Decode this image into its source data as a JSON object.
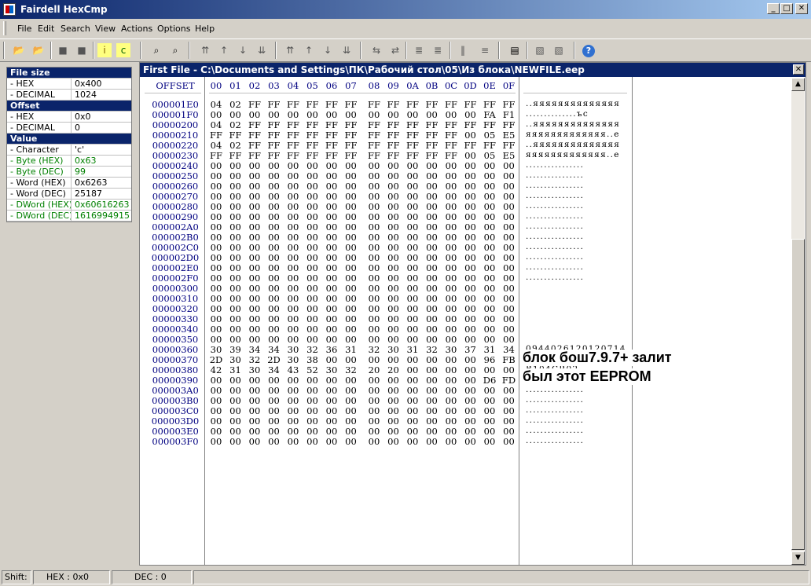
{
  "window": {
    "title": "Fairdell HexCmp"
  },
  "menu": [
    "File",
    "Edit",
    "Search",
    "View",
    "Actions",
    "Options",
    "Help"
  ],
  "toolbar": {
    "icons": [
      "open-file-1-icon",
      "open-file-2-icon",
      "stop-icon",
      "close-files-icon",
      "info-panel-icon",
      "compare-icon",
      "find-icon",
      "find-next-icon",
      "first-diff-icon",
      "prev-diff-icon",
      "next-diff-icon",
      "last-diff-icon",
      "first-block-icon",
      "prev-block-icon",
      "next-block-icon",
      "last-block-icon",
      "sync-left-icon",
      "sync-right-icon",
      "copy-left-icon",
      "copy-right-icon",
      "columns-icon",
      "lines-icon",
      "report-icon",
      "merge-left-icon",
      "merge-right-icon",
      "help-icon"
    ]
  },
  "info_panel": {
    "rows": [
      {
        "k": "File size",
        "v": "",
        "style": "hdr"
      },
      {
        "k": " - HEX",
        "v": "0x400",
        "style": ""
      },
      {
        "k": " - DECIMAL",
        "v": "1024",
        "style": ""
      },
      {
        "k": "Offset",
        "v": "",
        "style": "hdr"
      },
      {
        "k": " - HEX",
        "v": "0x0",
        "style": ""
      },
      {
        "k": " - DECIMAL",
        "v": "0",
        "style": ""
      },
      {
        "k": "Value",
        "v": "",
        "style": "hdr"
      },
      {
        "k": " - Character",
        "v": "'c'",
        "style": ""
      },
      {
        "k": " - Byte (HEX)",
        "v": "0x63",
        "style": "green"
      },
      {
        "k": " - Byte (DEC)",
        "v": "99",
        "style": "green"
      },
      {
        "k": " - Word (HEX)",
        "v": "0x6263",
        "style": ""
      },
      {
        "k": " - Word (DEC)",
        "v": "25187",
        "style": ""
      },
      {
        "k": " - DWord (HEX)",
        "v": "0x60616263",
        "style": "green"
      },
      {
        "k": " - DWord (DEC)",
        "v": "1616994915",
        "style": "green"
      }
    ]
  },
  "file_window": {
    "title": "First File - C:\\Documents and Settings\\ПК\\Рабочий стол\\05\\Из блока\\NEWFILE.eep",
    "offset_header": "OFFSET",
    "col_headers": [
      "00",
      "01",
      "02",
      "03",
      "04",
      "05",
      "06",
      "07",
      "08",
      "09",
      "0A",
      "0B",
      "0C",
      "0D",
      "0E",
      "0F"
    ],
    "rows": [
      {
        "o": "000001E0",
        "h": "04 02 FF FF FF FF FF FF FF FF FF FF FF FF FF FF",
        "a": "..яяяяяяяяяяяяяя"
      },
      {
        "o": "000001F0",
        "h": "00 00 00 00 00 00 00 00 00 00 00 00 00 00 FA F1",
        "a": "..............ъс"
      },
      {
        "o": "00000200",
        "h": "04 02 FF FF FF FF FF FF FF FF FF FF FF FF FF FF",
        "a": "..яяяяяяяяяяяяяя"
      },
      {
        "o": "00000210",
        "h": "FF FF FF FF FF FF FF FF FF FF FF FF FF 00 05 E5",
        "a": "яяяяяяяяяяяяя..е"
      },
      {
        "o": "00000220",
        "h": "04 02 FF FF FF FF FF FF FF FF FF FF FF FF FF FF",
        "a": "..яяяяяяяяяяяяяя"
      },
      {
        "o": "00000230",
        "h": "FF FF FF FF FF FF FF FF FF FF FF FF FF 00 05 E5",
        "a": "яяяяяяяяяяяяя..е"
      },
      {
        "o": "00000240",
        "h": "00 00 00 00 00 00 00 00 00 00 00 00 00 00 00 00",
        "a": "................"
      },
      {
        "o": "00000250",
        "h": "00 00 00 00 00 00 00 00 00 00 00 00 00 00 00 00",
        "a": "................"
      },
      {
        "o": "00000260",
        "h": "00 00 00 00 00 00 00 00 00 00 00 00 00 00 00 00",
        "a": "................"
      },
      {
        "o": "00000270",
        "h": "00 00 00 00 00 00 00 00 00 00 00 00 00 00 00 00",
        "a": "................"
      },
      {
        "o": "00000280",
        "h": "00 00 00 00 00 00 00 00 00 00 00 00 00 00 00 00",
        "a": "................"
      },
      {
        "o": "00000290",
        "h": "00 00 00 00 00 00 00 00 00 00 00 00 00 00 00 00",
        "a": "................"
      },
      {
        "o": "000002A0",
        "h": "00 00 00 00 00 00 00 00 00 00 00 00 00 00 00 00",
        "a": "................"
      },
      {
        "o": "000002B0",
        "h": "00 00 00 00 00 00 00 00 00 00 00 00 00 00 00 00",
        "a": "................"
      },
      {
        "o": "000002C0",
        "h": "00 00 00 00 00 00 00 00 00 00 00 00 00 00 00 00",
        "a": "................"
      },
      {
        "o": "000002D0",
        "h": "00 00 00 00 00 00 00 00 00 00 00 00 00 00 00 00",
        "a": "................"
      },
      {
        "o": "000002E0",
        "h": "00 00 00 00 00 00 00 00 00 00 00 00 00 00 00 00",
        "a": "................"
      },
      {
        "o": "000002F0",
        "h": "00 00 00 00 00 00 00 00 00 00 00 00 00 00 00 00",
        "a": "................"
      },
      {
        "o": "00000300",
        "h": "00 00 00 00 00 00 00 00 00 00 00 00 00 00 00 00",
        "a": ""
      },
      {
        "o": "00000310",
        "h": "00 00 00 00 00 00 00 00 00 00 00 00 00 00 00 00",
        "a": ""
      },
      {
        "o": "00000320",
        "h": "00 00 00 00 00 00 00 00 00 00 00 00 00 00 00 00",
        "a": ""
      },
      {
        "o": "00000330",
        "h": "00 00 00 00 00 00 00 00 00 00 00 00 00 00 00 00",
        "a": ""
      },
      {
        "o": "00000340",
        "h": "00 00 00 00 00 00 00 00 00 00 00 00 00 00 00 00",
        "a": ""
      },
      {
        "o": "00000350",
        "h": "00 00 00 00 00 00 00 00 00 00 00 00 00 00 00 00",
        "a": ""
      },
      {
        "o": "00000360",
        "h": "30 39 34 34 30 32 36 31 32 30 31 32 30 37 31 34",
        "a": "0944026120120714"
      },
      {
        "o": "00000370",
        "h": "2D 30 32 2D 30 38 00 00 00 00 00 00 00 00 96 FB",
        "a": "-02-08........-ы"
      },
      {
        "o": "00000380",
        "h": "42 31 30 34 43 52 30 32 20 20 00 00 00 00 00 00",
        "a": "B104CR02  ......"
      },
      {
        "o": "00000390",
        "h": "00 00 00 00 00 00 00 00 00 00 00 00 00 00 D6 FD",
        "a": "..............Цэ"
      },
      {
        "o": "000003A0",
        "h": "00 00 00 00 00 00 00 00 00 00 00 00 00 00 00 00",
        "a": "................"
      },
      {
        "o": "000003B0",
        "h": "00 00 00 00 00 00 00 00 00 00 00 00 00 00 00 00",
        "a": "................"
      },
      {
        "o": "000003C0",
        "h": "00 00 00 00 00 00 00 00 00 00 00 00 00 00 00 00",
        "a": "................"
      },
      {
        "o": "000003D0",
        "h": "00 00 00 00 00 00 00 00 00 00 00 00 00 00 00 00",
        "a": "................"
      },
      {
        "o": "000003E0",
        "h": "00 00 00 00 00 00 00 00 00 00 00 00 00 00 00 00",
        "a": "................"
      },
      {
        "o": "000003F0",
        "h": "00 00 00 00 00 00 00 00 00 00 00 00 00 00 00 00",
        "a": "................"
      }
    ],
    "overlay_text": [
      "блок бош7.9.7+ залит",
      "был этот EEPROM"
    ]
  },
  "status": {
    "shift": "Shift:",
    "hex": "HEX : 0x0",
    "dec": "DEC : 0"
  }
}
